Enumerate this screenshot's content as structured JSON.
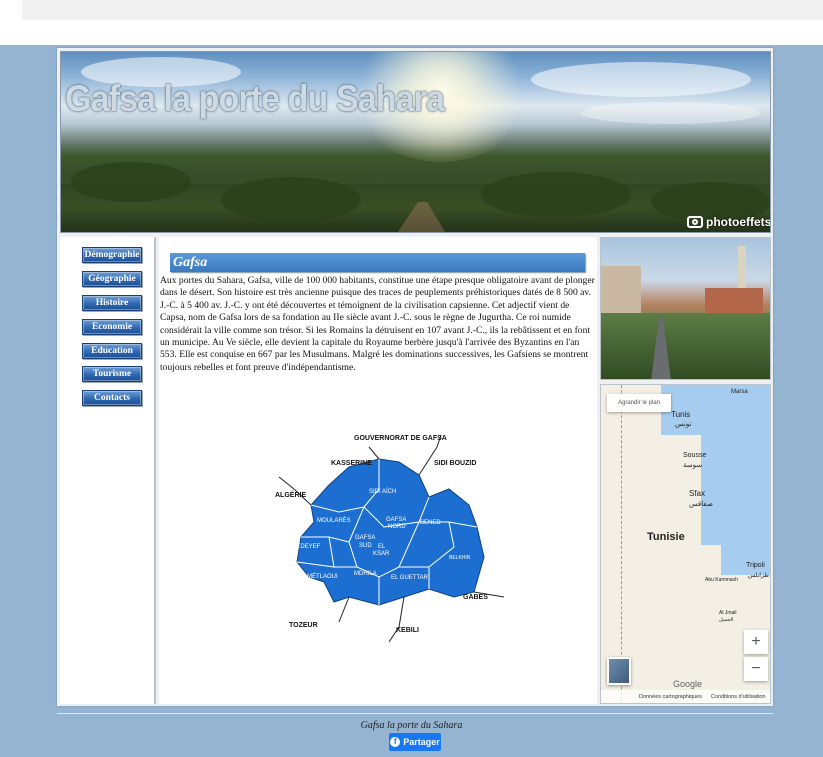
{
  "banner": {
    "title": "Gafsa la porte du Sahara",
    "watermark": "photoeffets"
  },
  "nav": {
    "items": [
      "Démographie",
      "Géographie",
      "Histoire",
      "Economie",
      "Education",
      "Tourisme",
      "Contacts"
    ]
  },
  "content": {
    "title": "Gafsa",
    "paragraph": "Aux portes du Sahara, Gafsa, ville de 100 000 habitants, constitue une étape presque obligatoire avant de plonger dans le désert. Son histoire est très ancienne puisque des traces de peuplements préhistoriques datés de 8 500 av. J.-C. à 5 400 av. J.-C. y ont été découvertes et témoignent de la civilisation capsienne. Cet adjectif vient de Capsa, nom de Gafsa lors de sa fondation au IIe siècle avant J.-C. sous le règne de Jugurtha. Ce roi numide considérait la ville comme son trésor. Si les Romains la détruisent en 107 avant J.-C., ils la rebâtissent et en font un municipe. Au Ve siècle, elle devient la capitale du Royaume berbère jusqu'à l'arrivée des Byzantins en l'an 553. Elle est conquise en 667 par les Musulmans. Malgré les dominations successives, les Gafsiens se montrent toujours rebelles et font preuve d'indépendantisme."
  },
  "region_map": {
    "title": "GOUVERNORAT DE GAFSA",
    "neighbors": {
      "kasserine": "KASSERINE",
      "sidi_bouzid": "SIDI BOUZID",
      "algerie": "ALGÉRIE",
      "gabes": "GABES",
      "tozeur": "TOZEUR",
      "kebili": "KEBILI"
    },
    "delegations": {
      "sidi_aich": [
        "SIDI AÏCH"
      ],
      "moulares": [
        "MOULARÈS"
      ],
      "gafsa_nord": [
        "GAFSA",
        "NORD"
      ],
      "sened": [
        "SENED"
      ],
      "redeyef": [
        "REDEYEF"
      ],
      "gafsa_sud": [
        "GAFSA",
        "SUD"
      ],
      "el_ksar": [
        "EL",
        "KSAR"
      ],
      "belkhir": [
        "BELKHIR"
      ],
      "metlaoui": [
        "MÉTLAOUI"
      ],
      "mdhila": [
        "MDHILA"
      ],
      "el_guettar": [
        "EL GUETTAR"
      ]
    },
    "fill_color": "#1c6fd1"
  },
  "google_map": {
    "enlarge_label": "Agrandir le plan",
    "places": {
      "marsa": "Marsa",
      "tunis": "Tunis",
      "tunis_ar": "تونس",
      "sousse": "Sousse",
      "sousse_ar": "سوسة",
      "sfax": "Sfax",
      "sfax_ar": "صفاقس",
      "tunisie": "Tunisie",
      "tripoli": "Tripoli",
      "tripoli_ar": "طرابلس",
      "al_jmail": "Al Jmail",
      "al_jmail_ar": "الجميل",
      "abu": "Abu Kammash"
    },
    "zoom_in": "+",
    "zoom_out": "−",
    "logo": "Google",
    "footer_data": "Données cartographiques",
    "footer_terms": "Conditions d'utilisation"
  },
  "footer": {
    "text": "Gafsa la porte du Sahara",
    "share_label": "Partager"
  }
}
